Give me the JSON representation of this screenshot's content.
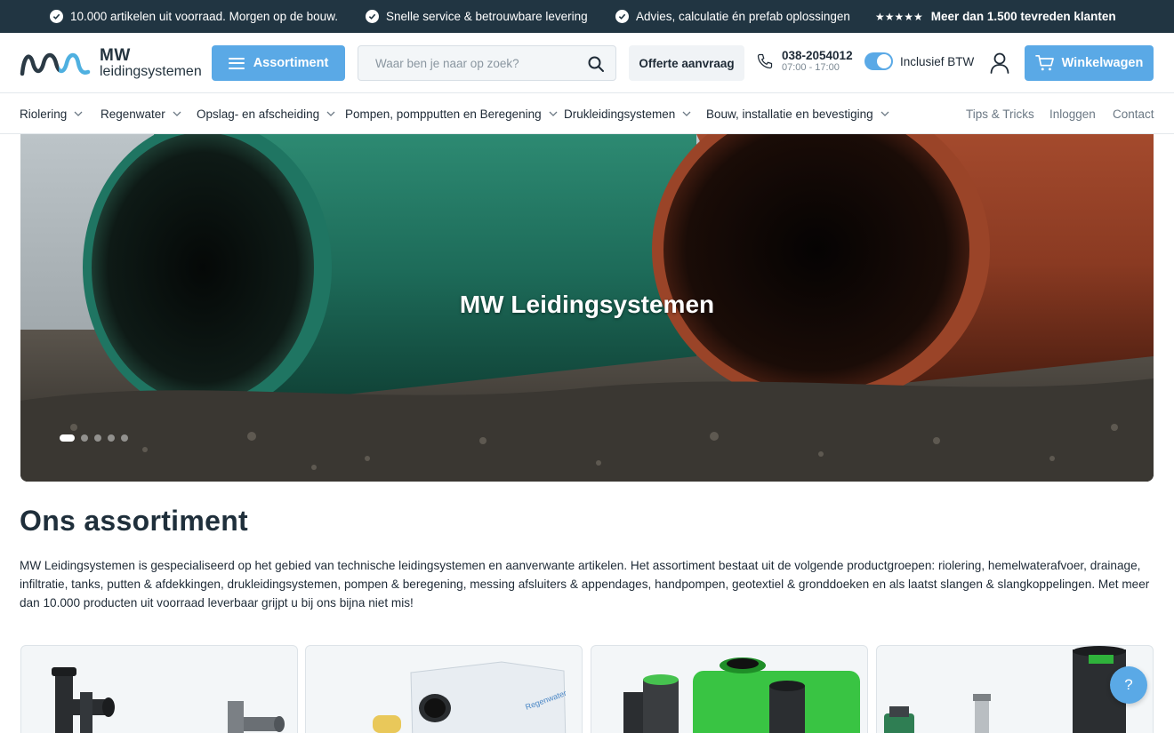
{
  "topbar": {
    "usp1": "10.000 artikelen uit voorraad. Morgen op de bouw.",
    "usp2": "Snelle service & betrouwbare levering",
    "usp3": "Advies, calculatie én prefab oplossingen",
    "rating_stars": "★★★★★",
    "rating_text": "Meer dan 1.500 tevreden klanten"
  },
  "header": {
    "logo_mw": "MW",
    "logo_sub": "leidingsystemen",
    "assortiment_label": "Assortiment",
    "search_placeholder": "Waar ben je naar op zoek?",
    "offerte_label": "Offerte aanvraag",
    "phone_number": "038-2054012",
    "phone_hours": "07:00 - 17:00",
    "btw_label": "Inclusief BTW",
    "btw_enabled": true,
    "cart_label": "Winkelwagen"
  },
  "nav": {
    "items": [
      {
        "label": "Riolering"
      },
      {
        "label": "Regenwater"
      },
      {
        "label": "Opslag- en afscheiding"
      },
      {
        "label": "Pompen, pompputten en Beregening"
      },
      {
        "label": "Drukleidingsystemen"
      },
      {
        "label": "Bouw, installatie en bevestiging"
      }
    ],
    "right": [
      "Tips & Tricks",
      "Inloggen",
      "Contact"
    ]
  },
  "hero": {
    "title": "MW Leidingsystemen",
    "slide_count": 5,
    "active_slide": 1
  },
  "assortiment": {
    "heading": "Ons assortiment",
    "intro": "MW Leidingsystemen is gespecialiseerd op het gebied van technische leidingsystemen en aanverwante artikelen. Het assortiment bestaat uit de volgende productgroepen: riolering, hemelwaterafvoer, drainage, infiltratie, tanks, putten & afdekkingen, drukleidingsystemen, pompen & beregening, messing afsluiters & appendages, handpompen, geotextiel & gronddoeken en als laatst slangen & slangkoppelingen.  Met meer dan 10.000 producten uit voorraad leverbaar grijpt u bij ons bijna niet mis!"
  },
  "help": {
    "label": "?"
  },
  "colors": {
    "topbar_bg": "#213542",
    "accent": "#5aa9e6",
    "text": "#1e2a36"
  }
}
